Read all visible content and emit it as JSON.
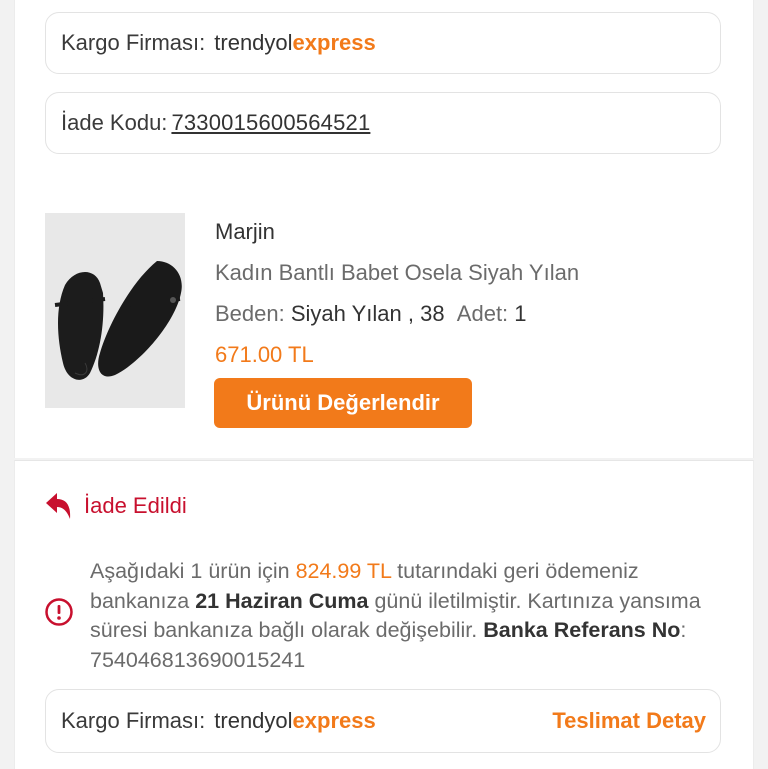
{
  "cargo_top": {
    "label": "Kargo Firması:",
    "brand_part1": "trendyol",
    "brand_part2": "express"
  },
  "return_code": {
    "label": "İade Kodu:",
    "value": "7330015600564521"
  },
  "product": {
    "image_icon": "shoe-icon",
    "seller": "Marjin",
    "name": "Kadın Bantlı Babet Osela Siyah Yılan",
    "size_label": "Beden:",
    "size_value": "Siyah Yılan , 38",
    "qty_label": "Adet:",
    "qty_value": "1",
    "price": "671.00 TL",
    "rate_button": "Ürünü Değerlendir"
  },
  "status": {
    "icon": "return-arrow-icon",
    "text": "İade Edildi",
    "color": "#c8102e"
  },
  "notice": {
    "icon": "info-icon",
    "t1": "Aşağıdaki 1 ürün için ",
    "amount": "824.99 TL",
    "t2": " tutarındaki geri ödemeniz bankanıza ",
    "date": "21 Haziran Cuma",
    "t3": " günü iletilmiştir. Kartınıza yansıma süresi bankanıza bağlı olarak değişebilir. ",
    "ref_label": "Banka Referans No",
    "t4": ": ",
    "ref_value": "754046813690015241"
  },
  "cargo_bottom": {
    "label": "Kargo Firması:",
    "brand_part1": "trendyol",
    "brand_part2": "express",
    "detail_link": "Teslimat Detay"
  },
  "colors": {
    "accent": "#f27a1a",
    "danger": "#c8102e"
  }
}
